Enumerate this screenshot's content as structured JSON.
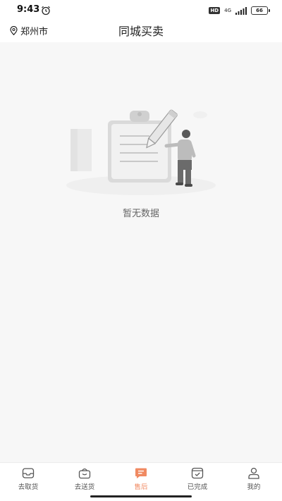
{
  "status_bar": {
    "time": "9:43",
    "hd": "HD",
    "network": "4G",
    "battery": "66"
  },
  "header": {
    "location": "郑州市",
    "title": "同城买卖"
  },
  "main": {
    "empty_text": "暂无数据"
  },
  "tabs": [
    {
      "label": "去取货",
      "icon": "inbox-tray-icon",
      "active": false
    },
    {
      "label": "去送货",
      "icon": "shopping-basket-icon",
      "active": false
    },
    {
      "label": "售后",
      "icon": "message-box-icon",
      "active": true
    },
    {
      "label": "已完成",
      "icon": "check-box-icon",
      "active": false
    },
    {
      "label": "我的",
      "icon": "user-icon",
      "active": false
    }
  ],
  "colors": {
    "accent": "#f08a62",
    "background": "#f7f7f7",
    "tab_text": "#555555"
  }
}
